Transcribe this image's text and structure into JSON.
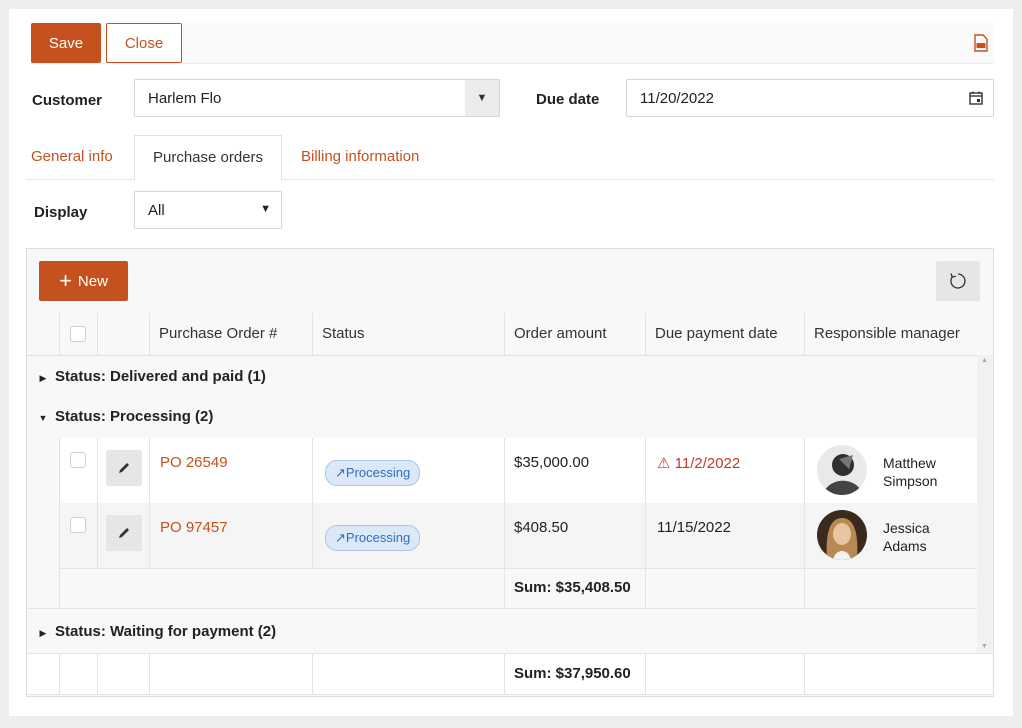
{
  "toolbar": {
    "save_label": "Save",
    "close_label": "Close",
    "pdf_icon": "pdf-icon"
  },
  "customer": {
    "label": "Customer",
    "value": "Harlem Flo"
  },
  "due_date": {
    "label": "Due date",
    "value": "11/20/2022"
  },
  "tabs": [
    {
      "label": "General info",
      "active": false
    },
    {
      "label": "Purchase orders",
      "active": true
    },
    {
      "label": "Billing information",
      "active": false
    }
  ],
  "display": {
    "label": "Display",
    "value": "All"
  },
  "grid": {
    "new_label": "New",
    "columns": [
      "Purchase Order #",
      "Status",
      "Order amount",
      "Due payment date",
      "Responsible manager"
    ],
    "groups": [
      {
        "label": "Status: Delivered and paid (1)",
        "expanded": false
      },
      {
        "label": "Status: Processing (2)",
        "expanded": true
      },
      {
        "label": "Status: Waiting for payment (2)",
        "expanded": false
      }
    ],
    "rows": [
      {
        "po": "PO 26549",
        "status": "Processing",
        "amount": "$35,000.00",
        "due": "11/2/2022",
        "overdue": true,
        "manager_first": "Matthew",
        "manager_last": "Simpson"
      },
      {
        "po": "PO 97457",
        "status": "Processing",
        "amount": "$408.50",
        "due": "11/15/2022",
        "overdue": false,
        "manager_first": "Jessica",
        "manager_last": "Adams"
      }
    ],
    "group_sum": "Sum: $35,408.50",
    "total_sum": "Sum: $37,950.60"
  },
  "colors": {
    "accent": "#c5521e",
    "badge_bg": "#dbe8f8",
    "badge_text": "#2f6fbf",
    "overdue": "#c0392b"
  }
}
